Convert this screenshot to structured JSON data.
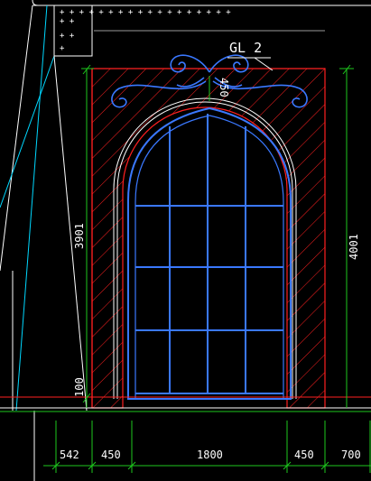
{
  "drawing": {
    "tag": "GL2",
    "tag_display": "GL 2",
    "arch_dimension": "450",
    "left_height": "3901",
    "right_height": "4001",
    "sill_height": "100",
    "bottom_dimensions": [
      "542",
      "450",
      "1800",
      "450",
      "700"
    ]
  },
  "colors": {
    "background": "#000000",
    "hatch": "#ff2020",
    "window_frame": "#3a78ff",
    "dimension_line": "#1ec81e",
    "reference_line": "#ffffff",
    "cyan_line": "#00d8ff"
  }
}
